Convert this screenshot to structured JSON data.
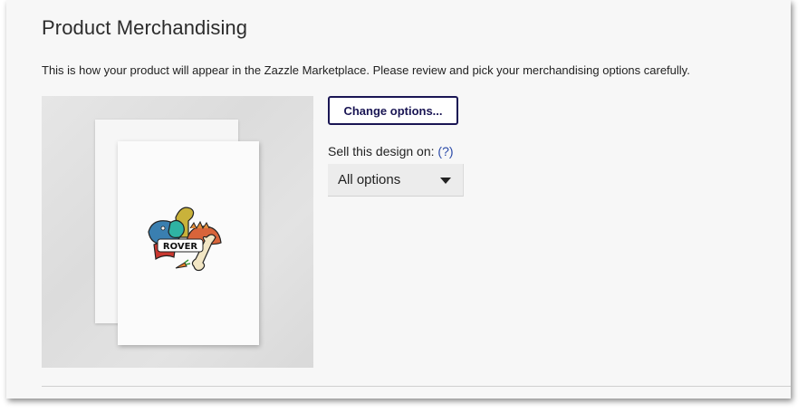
{
  "section": {
    "title": "Product Merchandising",
    "description": "This is how your product will appear in the Zazzle Marketplace. Please review and pick your merchandising options carefully."
  },
  "preview": {
    "card_text": "ROVER"
  },
  "actions": {
    "change_options_label": "Change options..."
  },
  "sell": {
    "label": "Sell this design on:",
    "help_label": "(?)",
    "selected_option": "All options"
  },
  "colors": {
    "accent": "#1a1654",
    "link": "#2a4aa8",
    "panel_background": "#f7f7f7"
  },
  "icons": {
    "dropdown": "caret-down-icon"
  }
}
